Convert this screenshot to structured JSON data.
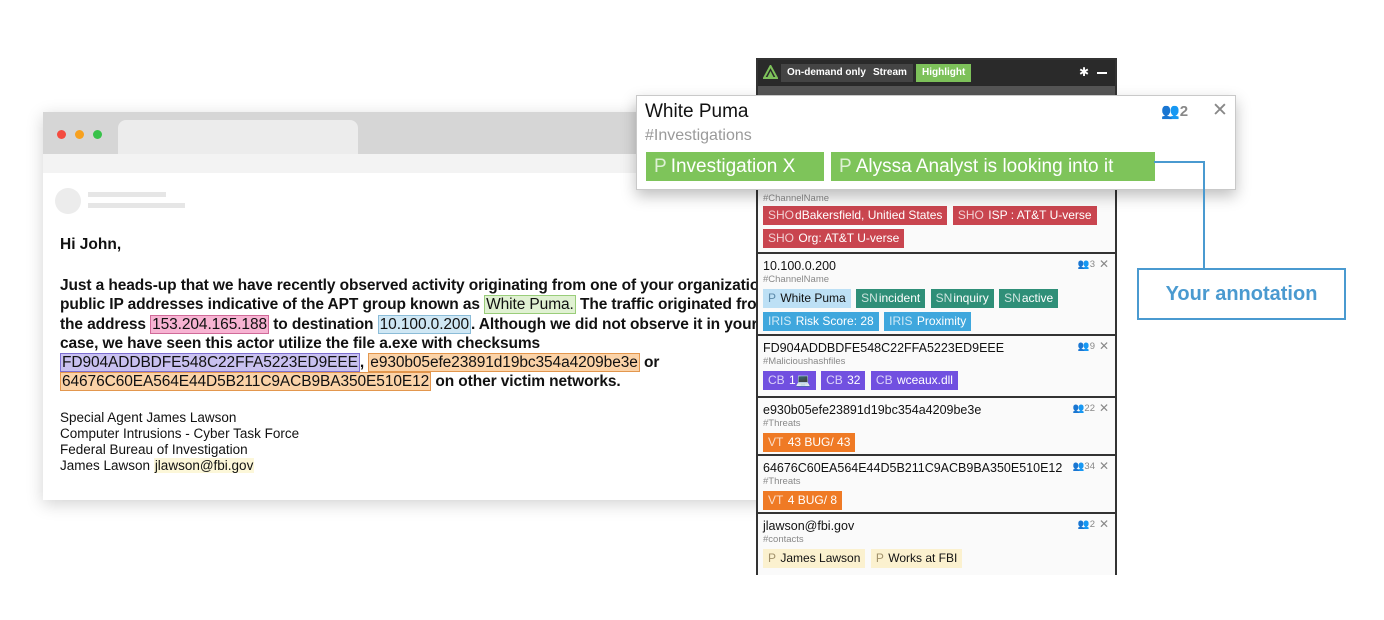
{
  "email": {
    "greeting": "Hi John,",
    "para_1": "Just a heads-up that we have recently observed activity originating from one of your organizations public IP addresses indicative of the APT group known as",
    "actor": "White Puma.",
    "para_2": "The traffic originated from the address",
    "ip_src": "153.204.165.188",
    "para_3": "to destination",
    "ip_dst": "10.100.0.200",
    "para_4": ".  Although we did not observe it in your case, we have seen this actor utilize the file a.exe with checksums",
    "hash_1": "FD904ADDBDFE548C22FFA5223ED9EEE",
    "comma": ",",
    "hash_2": "e930b05efe23891d19bc354a4209be3e",
    "or": "or",
    "hash_3": "64676C60EA564E44D5B211C9ACB9BA350E510E12",
    "para_5": "on other victim networks.",
    "signature": {
      "line_1": "Special Agent James Lawson",
      "line_2": "Computer Intrusions - Cyber Task Force",
      "line_3": "Federal Bureau of Investigation",
      "line_4_name": "James Lawson",
      "line_4_email": "jlawson@fbi.gov"
    }
  },
  "panel": {
    "modes": [
      "On-demand only",
      "Stream",
      "Highlight"
    ],
    "active_mode": "Highlight",
    "cards": [
      {
        "title": "",
        "channel": "#ChannelName",
        "count": "",
        "chips": [
          {
            "prefix": "SHO",
            "label": "dBakersfield, Unitied States",
            "color": "red"
          },
          {
            "prefix": "SHO",
            "label": " ISP : AT&T U-verse",
            "color": "red"
          },
          {
            "prefix": "SHO",
            "label": " Org: AT&T U-verse",
            "color": "red"
          }
        ]
      },
      {
        "title": "10.100.0.200",
        "channel": "#ChannelName",
        "count": "3",
        "chips": [
          {
            "prefix": "P",
            "label": "White Puma",
            "color": "lblue"
          },
          {
            "prefix": "SN",
            "label": "incident",
            "color": "teal"
          },
          {
            "prefix": "SN",
            "label": "inquiry",
            "color": "teal"
          },
          {
            "prefix": "SN",
            "label": "active",
            "color": "teal"
          },
          {
            "prefix": "IRIS",
            "label": "Risk Score: 28",
            "color": "sky"
          },
          {
            "prefix": "IRIS",
            "label": "Proximity",
            "color": "sky"
          }
        ]
      },
      {
        "title": "FD904ADDBDFE548C22FFA5223ED9EEE",
        "channel": "#Malicioushashfiles",
        "count": "9",
        "chips": [
          {
            "prefix": "CB",
            "label": "1💻",
            "color": "purple"
          },
          {
            "prefix": "CB",
            "label": "32",
            "color": "purple"
          },
          {
            "prefix": "CB",
            "label": "wceaux.dll",
            "color": "purple"
          }
        ]
      },
      {
        "title": "e930b05efe23891d19bc354a4209be3e",
        "channel": "#Threats",
        "count": "22",
        "chips": [
          {
            "prefix": "VT",
            "label": "43 BUG/ 43",
            "color": "orange"
          }
        ]
      },
      {
        "title": "64676C60EA564E44D5B211C9ACB9BA350E510E12",
        "channel": "#Threats",
        "count": "34",
        "chips": [
          {
            "prefix": "VT",
            "label": "4  BUG/ 8",
            "color": "orange"
          }
        ]
      },
      {
        "title": "jlawson@fbi.gov",
        "channel": "#contacts",
        "count": "2",
        "chips": [
          {
            "prefix": "P",
            "label": "James Lawson",
            "color": "cream"
          },
          {
            "prefix": "P",
            "label": "Works at FBI",
            "color": "cream"
          }
        ]
      }
    ]
  },
  "popup": {
    "title": "White Puma",
    "channel": "#Investigations",
    "count": "2",
    "tags": [
      {
        "prefix": "P",
        "label": "Investigation X"
      },
      {
        "prefix": "P",
        "label": "Alyssa Analyst is looking into it"
      }
    ]
  },
  "callout": {
    "label": "Your annotation"
  },
  "colors": {
    "accent_green": "#7ec45a",
    "callout_blue": "#4a9ad0",
    "chip_red": "#c9454f",
    "chip_teal": "#2f8f78",
    "chip_sky": "#3fa7dd",
    "chip_purple": "#7150e0",
    "chip_orange": "#ef7a25"
  }
}
